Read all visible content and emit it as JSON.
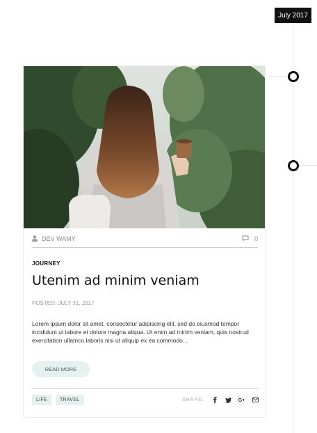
{
  "timeline": {
    "date_label": "July 2017"
  },
  "post": {
    "author": "DEV WAMY",
    "comments_count": "0",
    "category": "JOURNEY",
    "title": "Utenim ad minim veniam",
    "posted": "POSTED: JULY 31, 2017",
    "excerpt": "Lorem ipsum dolor sit amet, consectetur adipiscing elit, sed do eiusmod tempor incididunt ut labore et dolore magna aliqua. Ut enim ad minim veniam, quis nostrud exercitation ullamco laboris nisi ut aliquip ex ea commodo...",
    "read_more_label": "READ MORE",
    "tags": [
      "LIFE",
      "TRAVEL"
    ],
    "share_label": "SHARE:",
    "share_icons": [
      "facebook-icon",
      "twitter-icon",
      "google-plus-icon",
      "mail-icon"
    ]
  },
  "colors": {
    "accent_mint": "#e4f2ef",
    "badge_dark": "#111111"
  }
}
